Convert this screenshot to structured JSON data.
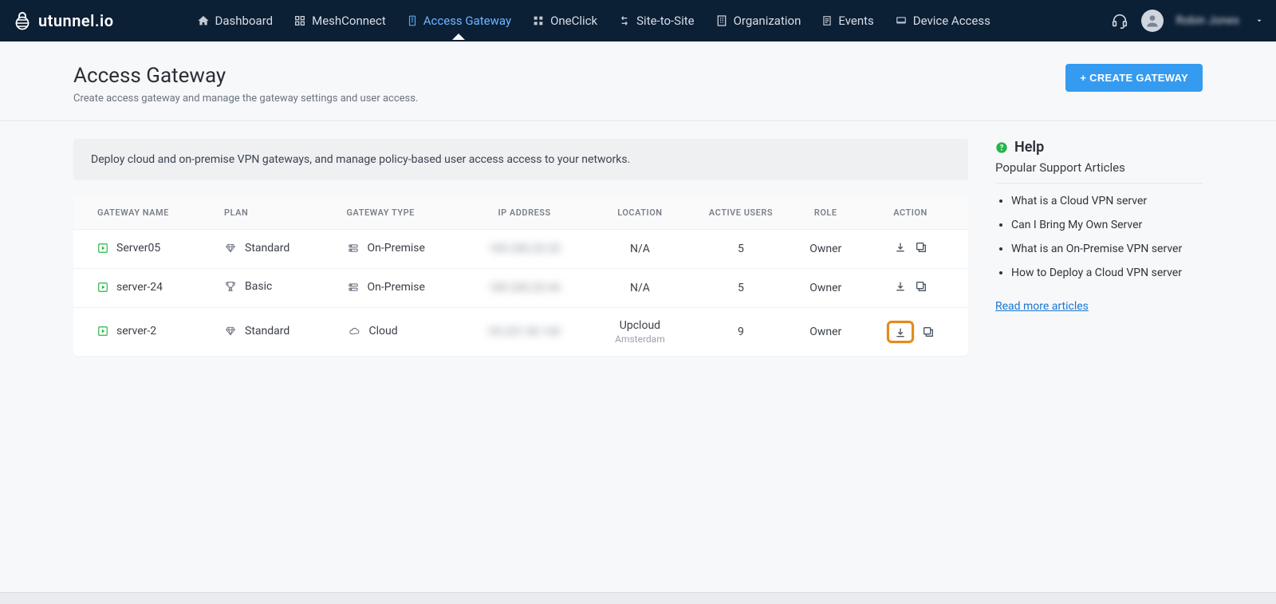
{
  "brand": "utunnel.io",
  "nav": {
    "items": [
      {
        "label": "Dashboard",
        "icon": "home-icon"
      },
      {
        "label": "MeshConnect",
        "icon": "mesh-icon"
      },
      {
        "label": "Access Gateway",
        "icon": "gateway-icon",
        "active": true
      },
      {
        "label": "OneClick",
        "icon": "oneclick-icon"
      },
      {
        "label": "Site-to-Site",
        "icon": "site-icon"
      },
      {
        "label": "Organization",
        "icon": "org-icon"
      },
      {
        "label": "Events",
        "icon": "events-icon"
      },
      {
        "label": "Device Access",
        "icon": "device-icon"
      }
    ],
    "username": "Robin Jones"
  },
  "header": {
    "title": "Access Gateway",
    "subtitle": "Create access gateway and manage the gateway settings and user access.",
    "create_btn": "+ CREATE GATEWAY"
  },
  "banner": "Deploy cloud and on-premise VPN gateways, and manage policy-based user access access to your networks.",
  "table": {
    "columns": {
      "name": "GATEWAY NAME",
      "plan": "PLAN",
      "type": "GATEWAY TYPE",
      "ip": "IP ADDRESS",
      "loc": "LOCATION",
      "users": "ACTIVE USERS",
      "role": "ROLE",
      "action": "ACTION"
    },
    "rows": [
      {
        "name": "Server05",
        "plan": "Standard",
        "type": "On-Premise",
        "ip": "189.200.20.20",
        "location": "N/A",
        "location_sub": "",
        "users": "5",
        "role": "Owner",
        "highlight_download": false
      },
      {
        "name": "server-24",
        "plan": "Basic",
        "type": "On-Premise",
        "ip": "189.200.20.44",
        "location": "N/A",
        "location_sub": "",
        "users": "5",
        "role": "Owner",
        "highlight_download": false
      },
      {
        "name": "server-2",
        "plan": "Standard",
        "type": "Cloud",
        "ip": "94.237.40.144",
        "location": "Upcloud",
        "location_sub": "Amsterdam",
        "users": "9",
        "role": "Owner",
        "highlight_download": true
      }
    ]
  },
  "help": {
    "title": "Help",
    "subtitle": "Popular Support Articles",
    "articles": [
      "What is a Cloud VPN server",
      "Can I Bring My Own Server",
      "What is an On-Premise VPN server",
      "How to Deploy a Cloud VPN server"
    ],
    "read_more": "Read more articles"
  }
}
